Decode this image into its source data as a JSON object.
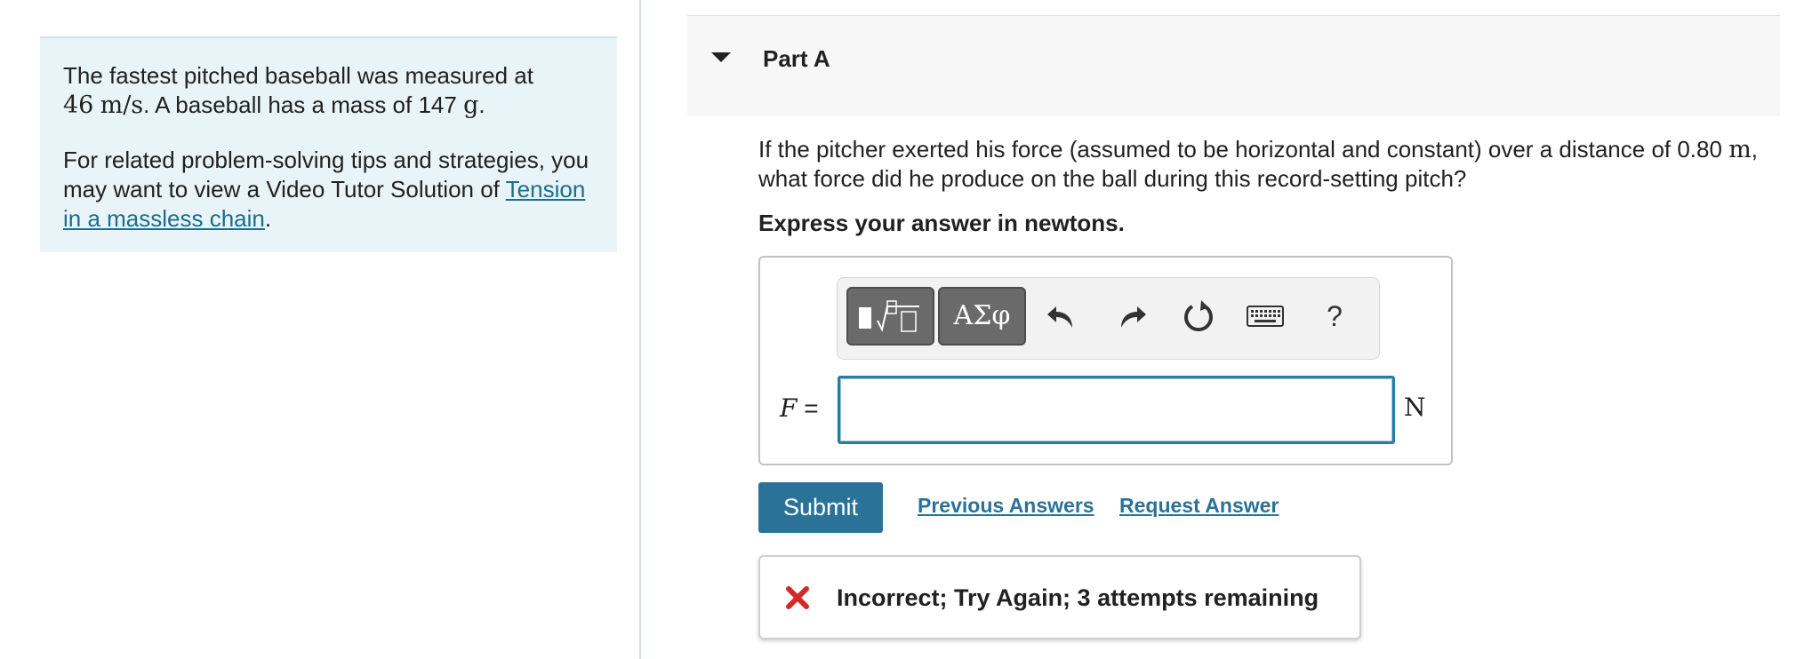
{
  "problem": {
    "intro_text": "The fastest pitched baseball was measured at",
    "speed_value": "46",
    "speed_unit": "m/s",
    "mass_text": ". A baseball has a mass of 147",
    "mass_unit": "g",
    "tips_text": "For related problem-solving tips and strategies, you may want to view a Video Tutor Solution of ",
    "tips_link": "Tension in a massless chain",
    "tips_end": "."
  },
  "part": {
    "title": "Part A",
    "question_text": "If the pitcher exerted his force (assumed to be horizontal and constant) over a distance of 0.80",
    "question_unit": "m",
    "question_text_2": ", what force did he produce on the ball during this record-setting pitch?",
    "instruction": "Express your answer in newtons."
  },
  "toolbar": {
    "greek_label": "ΑΣφ",
    "help_label": "?"
  },
  "answer": {
    "variable": "F",
    "equals": " =",
    "value": "",
    "unit": "N"
  },
  "actions": {
    "submit_label": "Submit",
    "previous_answers_label": "Previous Answers",
    "request_answer_label": "Request Answer"
  },
  "feedback": {
    "message": "Incorrect; Try Again; 3 attempts remaining",
    "status_color": "#d12a2a"
  },
  "colors": {
    "accent": "#2a7298",
    "info_panel_bg": "#e8f4f7"
  }
}
